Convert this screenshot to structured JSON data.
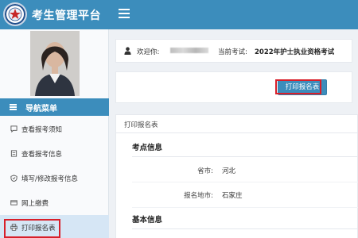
{
  "app": {
    "title": "考生管理平台"
  },
  "sidebar": {
    "header": "导航菜单",
    "items": [
      {
        "label": "查看报考须知",
        "icon": "message-icon"
      },
      {
        "label": "查看报考信息",
        "icon": "document-icon"
      },
      {
        "label": "填写/修改报考信息",
        "icon": "shield-icon"
      },
      {
        "label": "网上缴费",
        "icon": "card-icon"
      },
      {
        "label": "打印报名表",
        "icon": "printer-icon",
        "active": true
      }
    ]
  },
  "welcome": {
    "greeting": "欢迎你:",
    "exam_label": "当前考试:",
    "exam_name": "2022年护士执业资格考试"
  },
  "actions": {
    "print_button": "打印报名表"
  },
  "form": {
    "title": "打印报名表",
    "sections": {
      "exam_site": {
        "heading": "考点信息",
        "rows": [
          {
            "label": "省市:",
            "value": "河北"
          },
          {
            "label": "报名地市:",
            "value": "石家庄"
          }
        ]
      },
      "basic": {
        "heading": "基本信息"
      }
    }
  },
  "colors": {
    "primary": "#3c8dbc",
    "highlight": "#d81f2a",
    "sidebar_bg": "#f9fafc",
    "content_bg": "#eef1f5"
  }
}
